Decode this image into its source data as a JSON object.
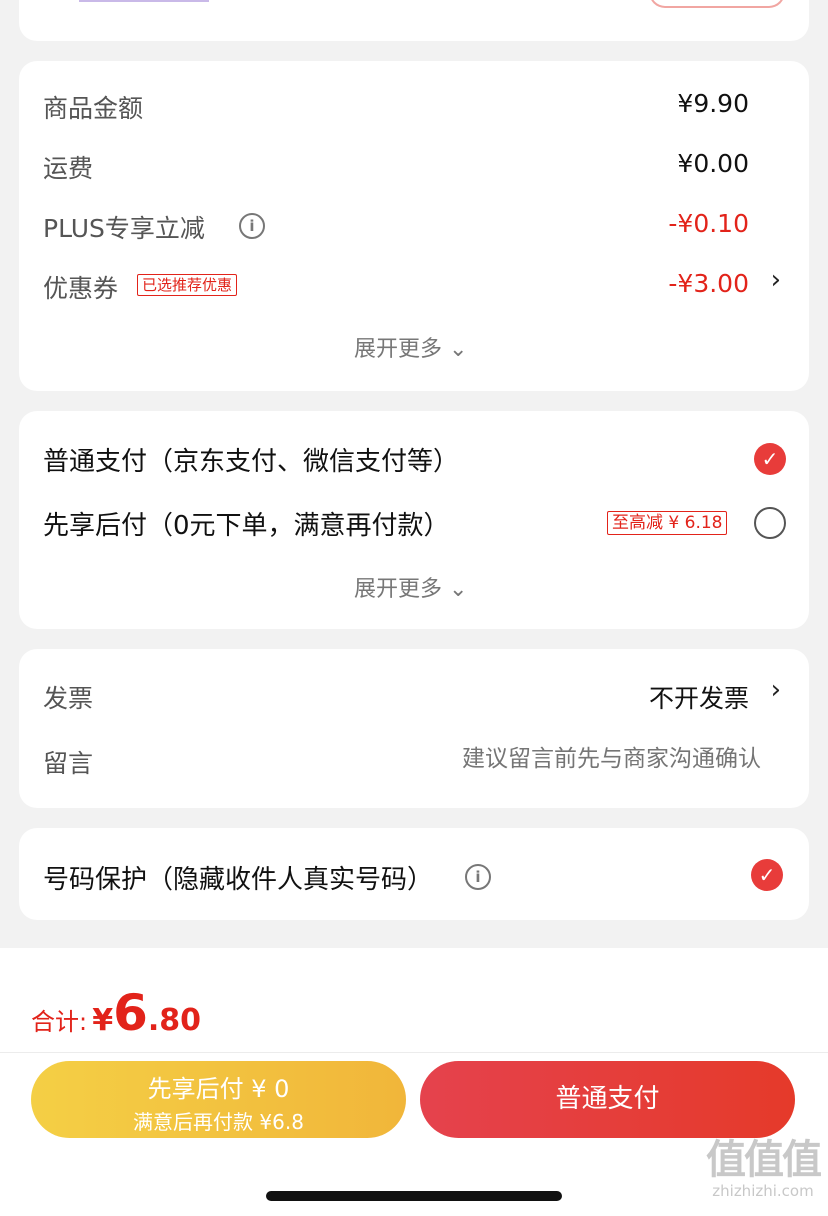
{
  "summary": {
    "goods_amount": {
      "label": "商品金额",
      "value": "¥9.90"
    },
    "shipping": {
      "label": "运费",
      "value": "¥0.00"
    },
    "plus_discount": {
      "label": "PLUS专享立减",
      "value": "-¥0.10",
      "info_icon": "i"
    },
    "coupon": {
      "label": "优惠券",
      "tag": "已选推荐优惠",
      "value": "-¥3.00",
      "chevron": "›"
    },
    "expand_more": "展开更多 ⌄"
  },
  "payment": {
    "normal": {
      "label": "普通支付（京东支付、微信支付等）",
      "selected": true
    },
    "pay_later": {
      "label": "先享后付（0元下单，满意再付款）",
      "tag": "至高减 ¥ 6.18",
      "selected": false
    },
    "expand_more": "展开更多 ⌄"
  },
  "invoice": {
    "label": "发票",
    "value": "不开发票",
    "chevron": "›"
  },
  "message": {
    "label": "留言",
    "placeholder": "建议留言前先与商家沟通确认"
  },
  "privacy": {
    "label": "号码保护（隐藏收件人真实号码）",
    "info_icon": "i",
    "selected": true
  },
  "total": {
    "label": "合计:",
    "currency": "¥",
    "integer": "6",
    "decimal": ".80"
  },
  "buttons": {
    "pay_later_line1": "先享后付 ¥ 0",
    "pay_later_line2": "满意后再付款 ¥6.8",
    "normal_pay": "普通支付"
  },
  "watermark": {
    "mark": "值值值",
    "site": "zhizhizhi.com"
  },
  "colors": {
    "accent_red": "#e2231a",
    "button_yellow": "#f2c23f",
    "button_red": "#e53f3a",
    "background": "#f2f2f2"
  }
}
